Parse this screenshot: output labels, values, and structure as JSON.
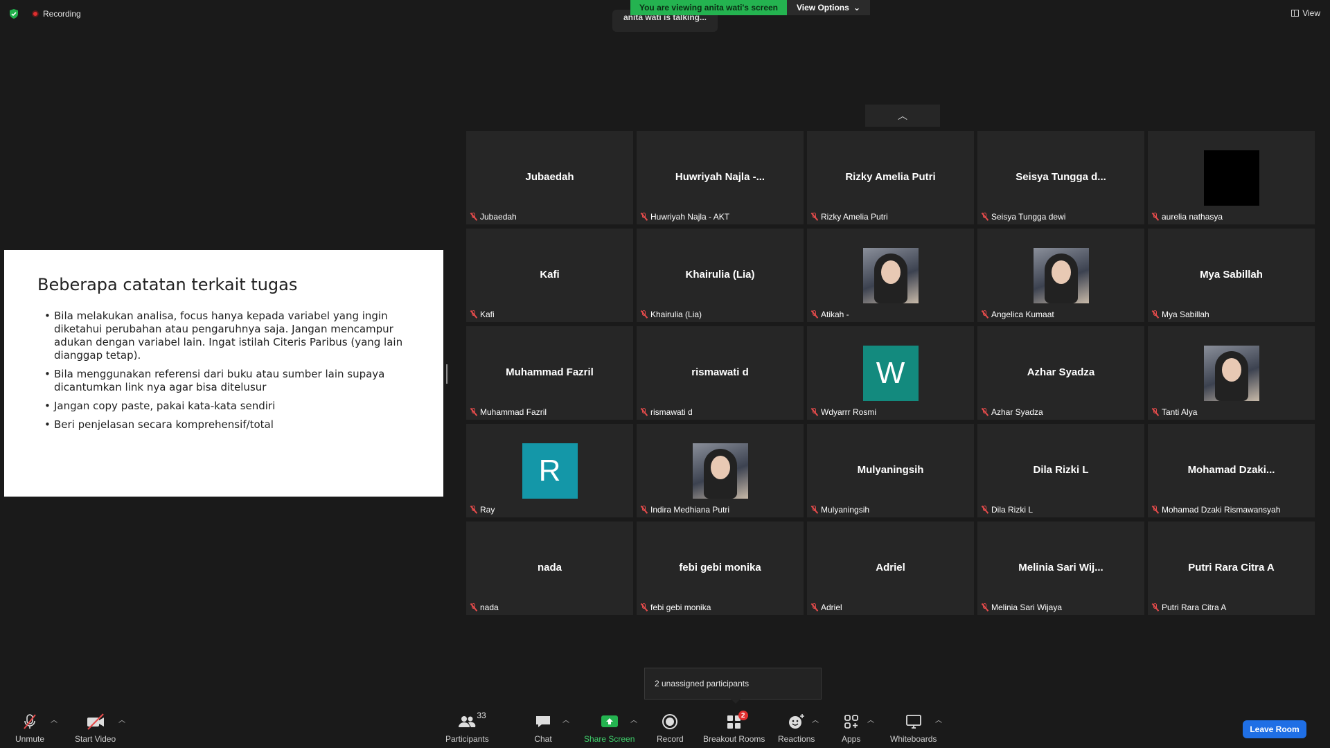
{
  "top": {
    "recording": "Recording",
    "viewing_banner": "You are viewing anita wati's screen",
    "view_options": "View Options",
    "talking": "anita wati is talking...",
    "view": "View"
  },
  "slide": {
    "title": "Beberapa catatan terkait tugas",
    "bullets": [
      "Bila melakukan analisa, focus hanya kepada variabel yang ingin diketahui perubahan atau pengaruhnya saja. Jangan mencampur adukan dengan variabel lain. Ingat istilah Citeris Paribus (yang lain dianggap tetap).",
      "Bila menggunakan referensi dari buku atau sumber lain supaya dicantumkan link nya agar bisa ditelusur",
      "Jangan copy paste, pakai kata-kata sendiri",
      "Beri penjelasan secara komprehensif/total"
    ]
  },
  "tiles": [
    {
      "display": "Jubaedah",
      "label": "Jubaedah"
    },
    {
      "display": "Huwriyah  Najla  -...",
      "label": "Huwriyah Najla - AKT"
    },
    {
      "display": "Rizky Amelia Putri",
      "label": "Rizky Amelia Putri"
    },
    {
      "display": "Seisya  Tungga  d...",
      "label": "Seisya Tungga dewi"
    },
    {
      "display": "",
      "label": "aurelia nathasya",
      "avatar": "black"
    },
    {
      "display": "Kafi",
      "label": "Kafi"
    },
    {
      "display": "Khairulia (Lia)",
      "label": "Khairulia (Lia)"
    },
    {
      "display": "",
      "label": "Atikah -",
      "avatar": "photo"
    },
    {
      "display": "",
      "label": "Angelica Kumaat",
      "avatar": "photo"
    },
    {
      "display": "Mya Sabillah",
      "label": "Mya Sabillah"
    },
    {
      "display": "Muhammad Fazril",
      "label": "Muhammad Fazril"
    },
    {
      "display": "rismawati d",
      "label": "rismawati d"
    },
    {
      "display": "W",
      "label": "Wdyarrr Rosmi",
      "avatar": "letter",
      "color": "#138a7e"
    },
    {
      "display": "Azhar Syadza",
      "label": "Azhar Syadza"
    },
    {
      "display": "",
      "label": "Tanti Alya",
      "avatar": "photo"
    },
    {
      "display": "R",
      "label": "Ray",
      "avatar": "letter",
      "color": "#1497a8"
    },
    {
      "display": "",
      "label": "Indira Medhiana Putri",
      "avatar": "photo"
    },
    {
      "display": "Mulyaningsih",
      "label": "Mulyaningsih"
    },
    {
      "display": "Dila Rizki L",
      "label": "Dila Rizki L"
    },
    {
      "display": "Mohamad  Dzaki...",
      "label": "Mohamad Dzaki Rismawansyah"
    },
    {
      "display": "nada",
      "label": "nada"
    },
    {
      "display": "febi gebi monika",
      "label": "febi gebi monika"
    },
    {
      "display": "Adriel",
      "label": "Adriel"
    },
    {
      "display": "Melinia  Sari  Wij...",
      "label": "Melinia Sari Wijaya"
    },
    {
      "display": "Putri Rara Citra A",
      "label": "Putri Rara Citra A"
    }
  ],
  "popup": "2 unassigned participants",
  "toolbar": {
    "unmute": "Unmute",
    "start_video": "Start Video",
    "participants": "Participants",
    "participants_count": "33",
    "chat": "Chat",
    "share_screen": "Share Screen",
    "record": "Record",
    "breakout_rooms": "Breakout Rooms",
    "breakout_badge": "2",
    "reactions": "Reactions",
    "apps": "Apps",
    "whiteboards": "Whiteboards",
    "leave_room": "Leave Room"
  },
  "colors": {
    "share_green": "#24b350",
    "leave_blue": "#1f6fe5",
    "muted_red": "#e34b4b"
  }
}
